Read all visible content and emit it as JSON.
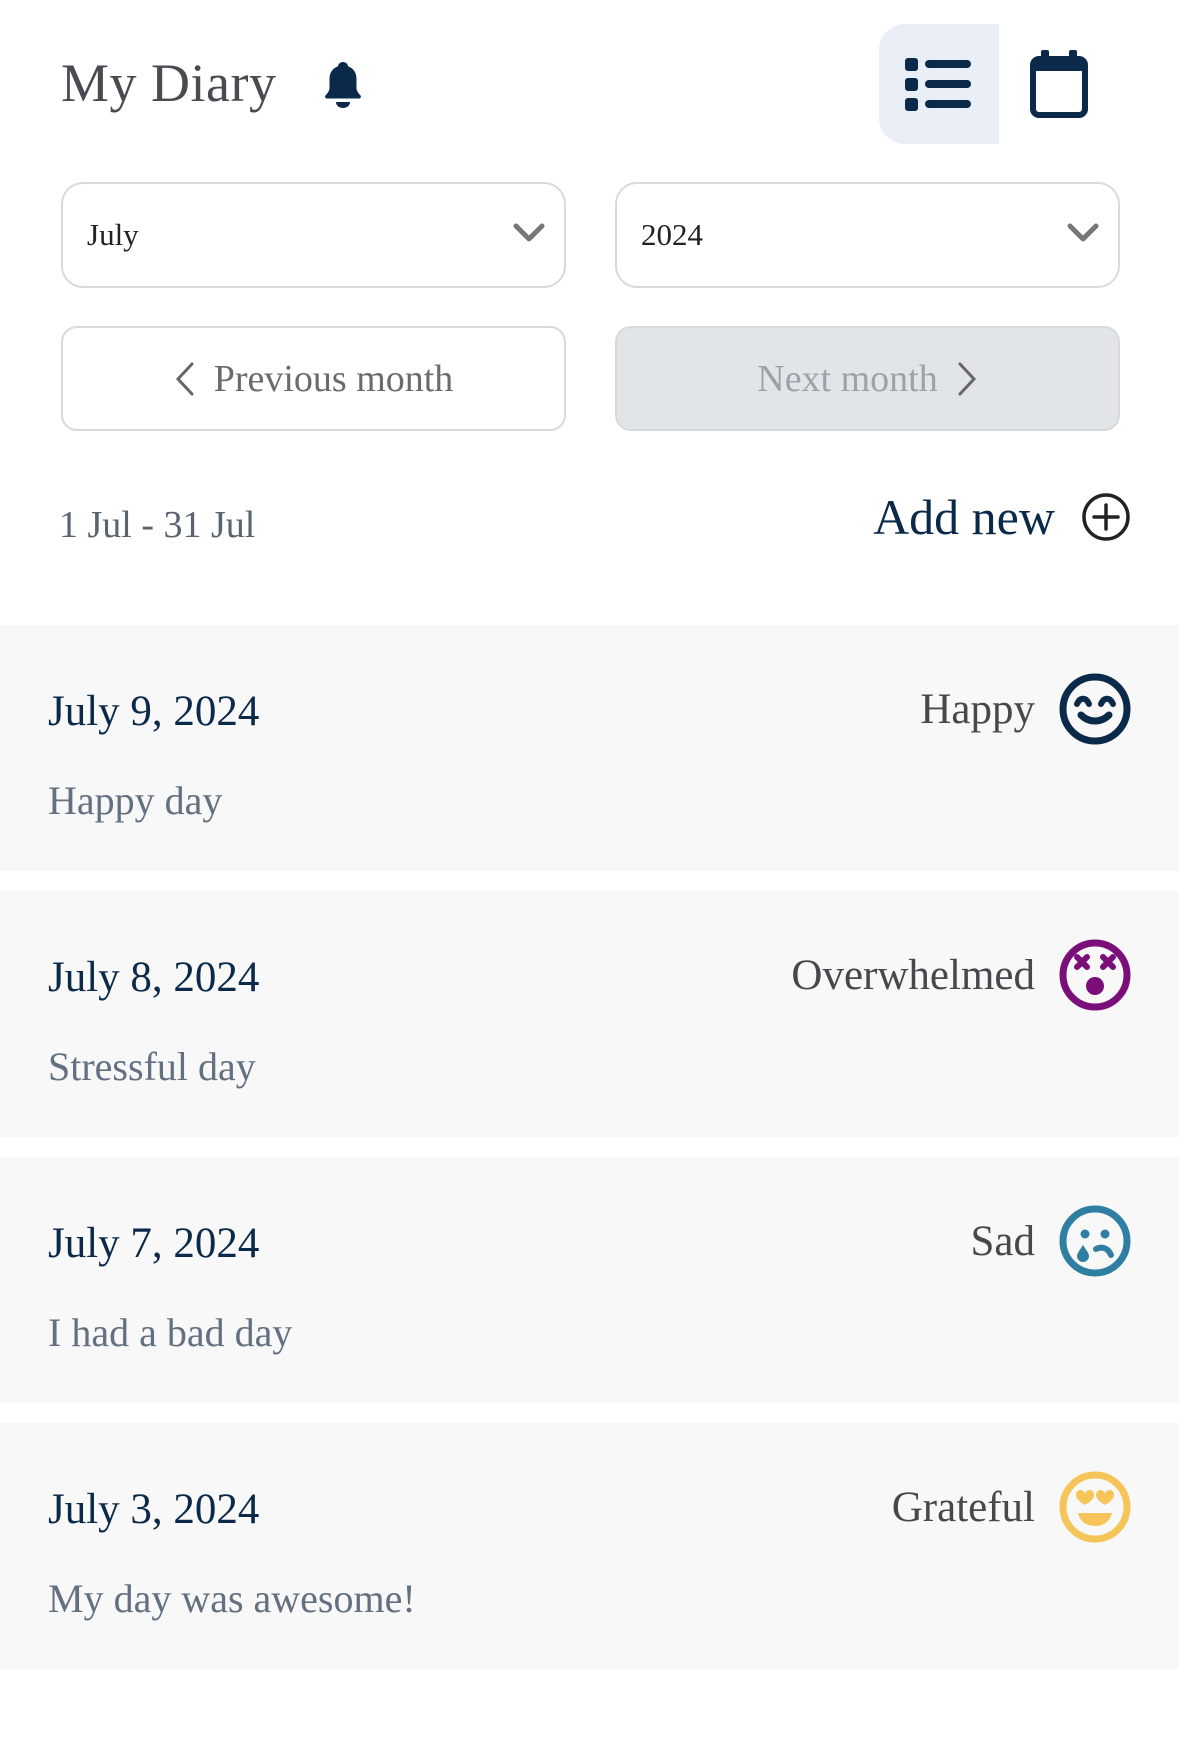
{
  "header": {
    "title": "My Diary",
    "bell_icon": "bell-icon",
    "view_modes": [
      {
        "name": "list",
        "icon": "list-icon",
        "active": true
      },
      {
        "name": "calendar",
        "icon": "calendar-icon",
        "active": false
      }
    ]
  },
  "filters": {
    "month": {
      "value": "July"
    },
    "year": {
      "value": "2024"
    }
  },
  "navigation": {
    "previous_label": "Previous month",
    "next_label": "Next month",
    "next_disabled": true
  },
  "range": {
    "label": "1 Jul - 31 Jul",
    "add_new_label": "Add new"
  },
  "colors": {
    "primary": "#0b2a4a",
    "happy": "#0b2a4a",
    "overwhelmed": "#7a0f7a",
    "sad": "#2f7fa3",
    "grateful": "#f6c55a"
  },
  "entries": [
    {
      "date": "July 9, 2024",
      "mood": "Happy",
      "mood_icon": "happy-face-icon",
      "note": "Happy day"
    },
    {
      "date": "July 8, 2024",
      "mood": "Overwhelmed",
      "mood_icon": "dizzy-face-icon",
      "note": "Stressful day"
    },
    {
      "date": "July 7, 2024",
      "mood": "Sad",
      "mood_icon": "crying-face-icon",
      "note": "I had a bad day"
    },
    {
      "date": "July 3, 2024",
      "mood": "Grateful",
      "mood_icon": "heart-eyes-face-icon",
      "note": "My day was awesome!"
    }
  ]
}
